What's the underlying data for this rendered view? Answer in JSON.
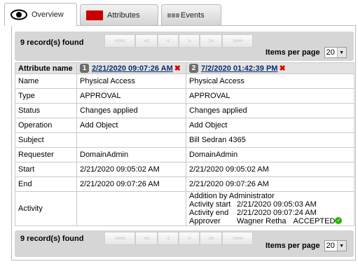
{
  "tabs": [
    {
      "label": "Overview",
      "icon": "eye-icon",
      "active": true
    },
    {
      "label": "Attributes",
      "icon": "red-block-icon",
      "active": false
    },
    {
      "label": "Events",
      "icon": "events-icon",
      "active": false
    }
  ],
  "pager": {
    "records_found": "9 record(s) found",
    "buttons": [
      "<<<<",
      "<<",
      "<",
      ">",
      ">>",
      ">>>>"
    ],
    "items_per_page_label": "Items per page",
    "items_per_page_value": "20"
  },
  "table": {
    "header_label": "Attribute name",
    "columns": [
      {
        "num": "1",
        "title": "2/21/2020 09:07:26 AM"
      },
      {
        "num": "2",
        "title": "7/2/2020 01:42:39 PM"
      }
    ],
    "rows": [
      {
        "name": "Name",
        "v1": "Physical Access",
        "v2": "Physical Access"
      },
      {
        "name": "Type",
        "v1": "APPROVAL",
        "v2": "APPROVAL"
      },
      {
        "name": "Status",
        "v1": "Changes applied",
        "v2": "Changes applied"
      },
      {
        "name": "Operation",
        "v1": "Add Object",
        "v2": "Add Object"
      },
      {
        "name": "Subject",
        "v1": "",
        "v2": "Bill Sedran 4365"
      },
      {
        "name": "Requester",
        "v1": "DomainAdmin",
        "v2": "DomainAdmin"
      },
      {
        "name": "Start",
        "v1": "2/21/2020 09:05:02 AM",
        "v2": "2/21/2020 09:05:02 AM"
      },
      {
        "name": "End",
        "v1": "2/21/2020 09:07:26 AM",
        "v2": "2/21/2020 09:07:26 AM"
      }
    ],
    "activity": {
      "name": "Activity",
      "v1": "",
      "line1": "Addition by Administrator",
      "start_label": "Activity start",
      "start_value": "2/21/2020 09:05:03 AM",
      "end_label": "Activity end",
      "end_value": "2/21/2020 09:07:24 AM",
      "approver_label": "Approver",
      "approver_value": "Wagner Retha",
      "status": "ACCEPTED"
    }
  },
  "colors": {
    "accent_red": "#c80000",
    "ok_green": "#27b300",
    "link": "#0a2a6e"
  }
}
